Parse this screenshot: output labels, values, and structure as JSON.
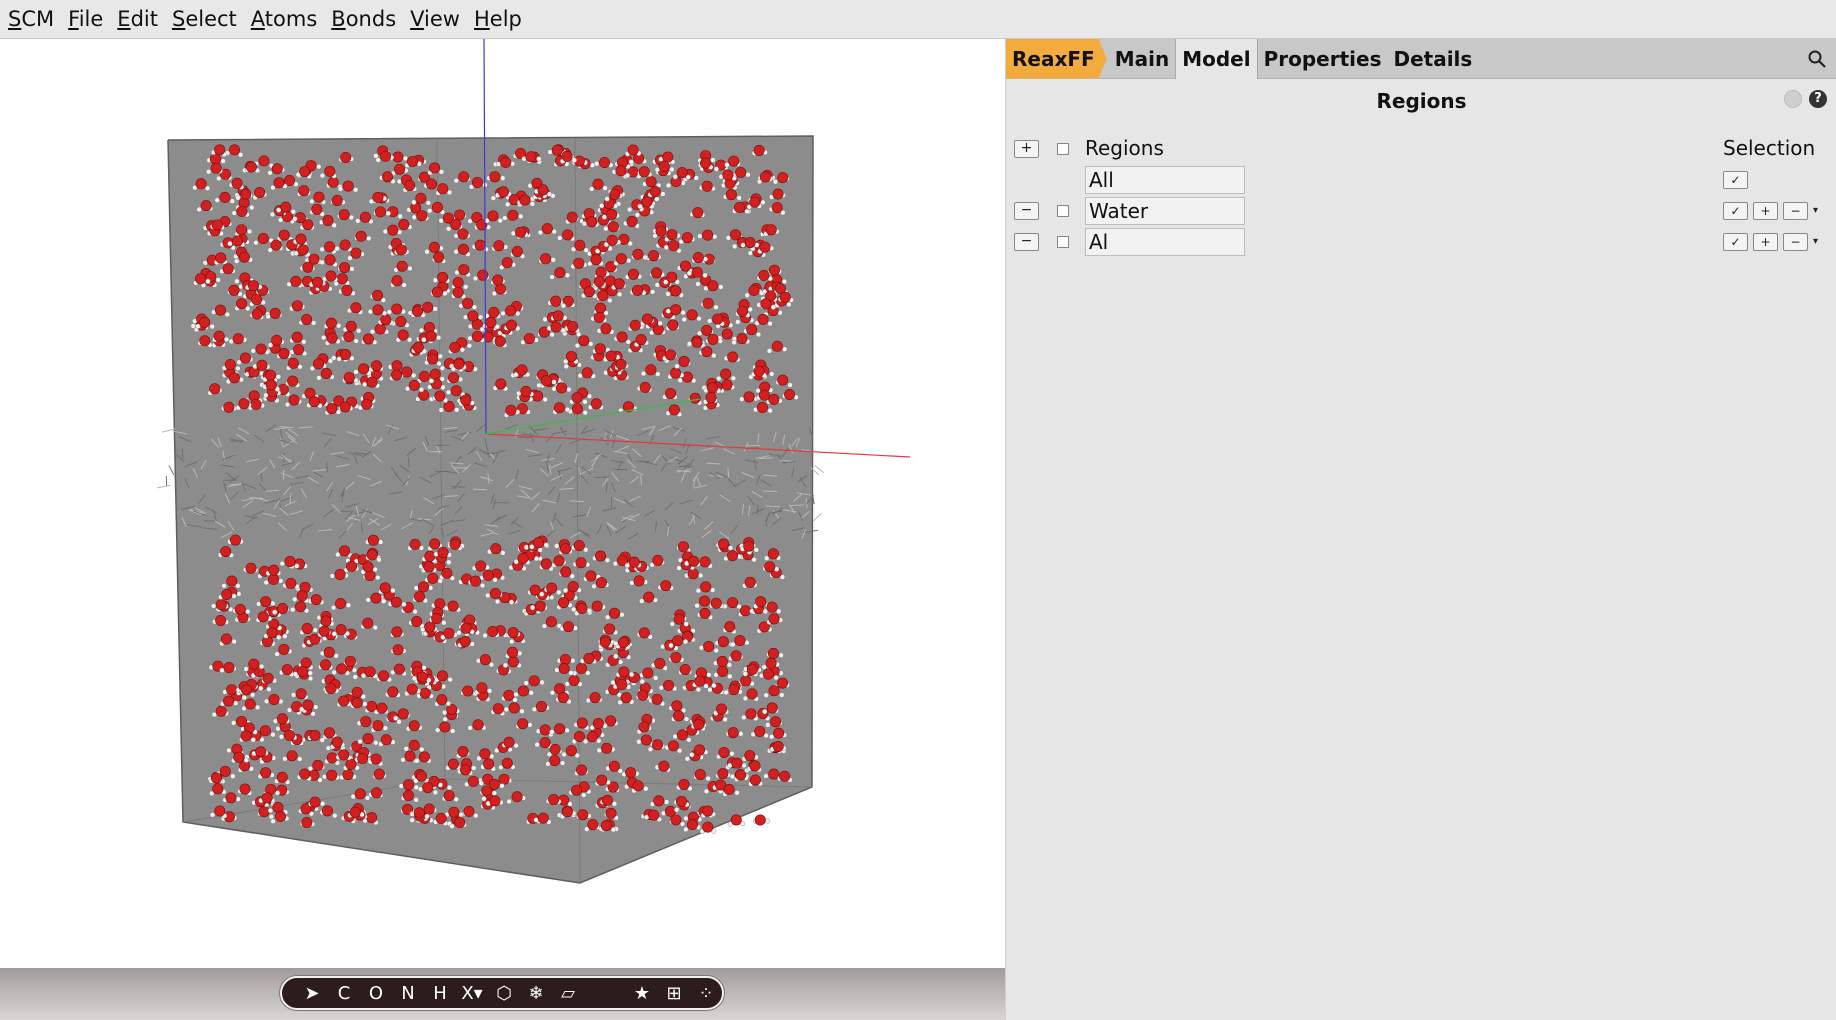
{
  "menubar": {
    "items": [
      {
        "accel": "S",
        "rest": "CM"
      },
      {
        "accel": "F",
        "rest": "ile"
      },
      {
        "accel": "E",
        "rest": "dit"
      },
      {
        "accel": "S",
        "rest": "elect"
      },
      {
        "accel": "A",
        "rest": "toms"
      },
      {
        "accel": "B",
        "rest": "onds"
      },
      {
        "accel": "V",
        "rest": "iew"
      },
      {
        "accel": "H",
        "rest": "elp"
      }
    ]
  },
  "tabs": {
    "brand": "ReaxFF",
    "main": "Main",
    "model": "Model",
    "properties": "Properties",
    "details": "Details",
    "active": "Model"
  },
  "panel": {
    "title": "Regions",
    "help_glyph": "?",
    "header_label": "Regions",
    "selection_label": "Selection",
    "add_glyph": "+",
    "remove_glyph": "−",
    "check_glyph": "✓",
    "plus_glyph": "+",
    "minus_glyph": "−",
    "dropdown_glyph": "▾",
    "regions": [
      {
        "name": "All"
      },
      {
        "name": "Water"
      },
      {
        "name": "Al"
      }
    ]
  },
  "toolbar": {
    "buttons": [
      {
        "glyph": "➤",
        "icon": "select-arrow-icon"
      },
      {
        "glyph": "C",
        "icon": "carbon-element"
      },
      {
        "glyph": "O",
        "icon": "oxygen-element"
      },
      {
        "glyph": "N",
        "icon": "nitrogen-element"
      },
      {
        "glyph": "H",
        "icon": "hydrogen-element"
      },
      {
        "glyph": "X▾",
        "icon": "element-picker"
      },
      {
        "glyph": "⬡",
        "icon": "ring-icon"
      },
      {
        "glyph": "❄",
        "icon": "snowflake-icon"
      },
      {
        "glyph": "▱",
        "icon": "plane-icon"
      },
      {
        "glyph": "★",
        "icon": "favorites-star-icon"
      },
      {
        "glyph": "⊞",
        "icon": "fit-view-icon"
      },
      {
        "glyph": "⁘",
        "icon": "molecules-icon"
      }
    ]
  },
  "colors": {
    "brand_tab": "#f4ab3e",
    "oxygen": "#d22020",
    "hydrogen": "#f0f0f0",
    "box": "#8c8c8c"
  }
}
